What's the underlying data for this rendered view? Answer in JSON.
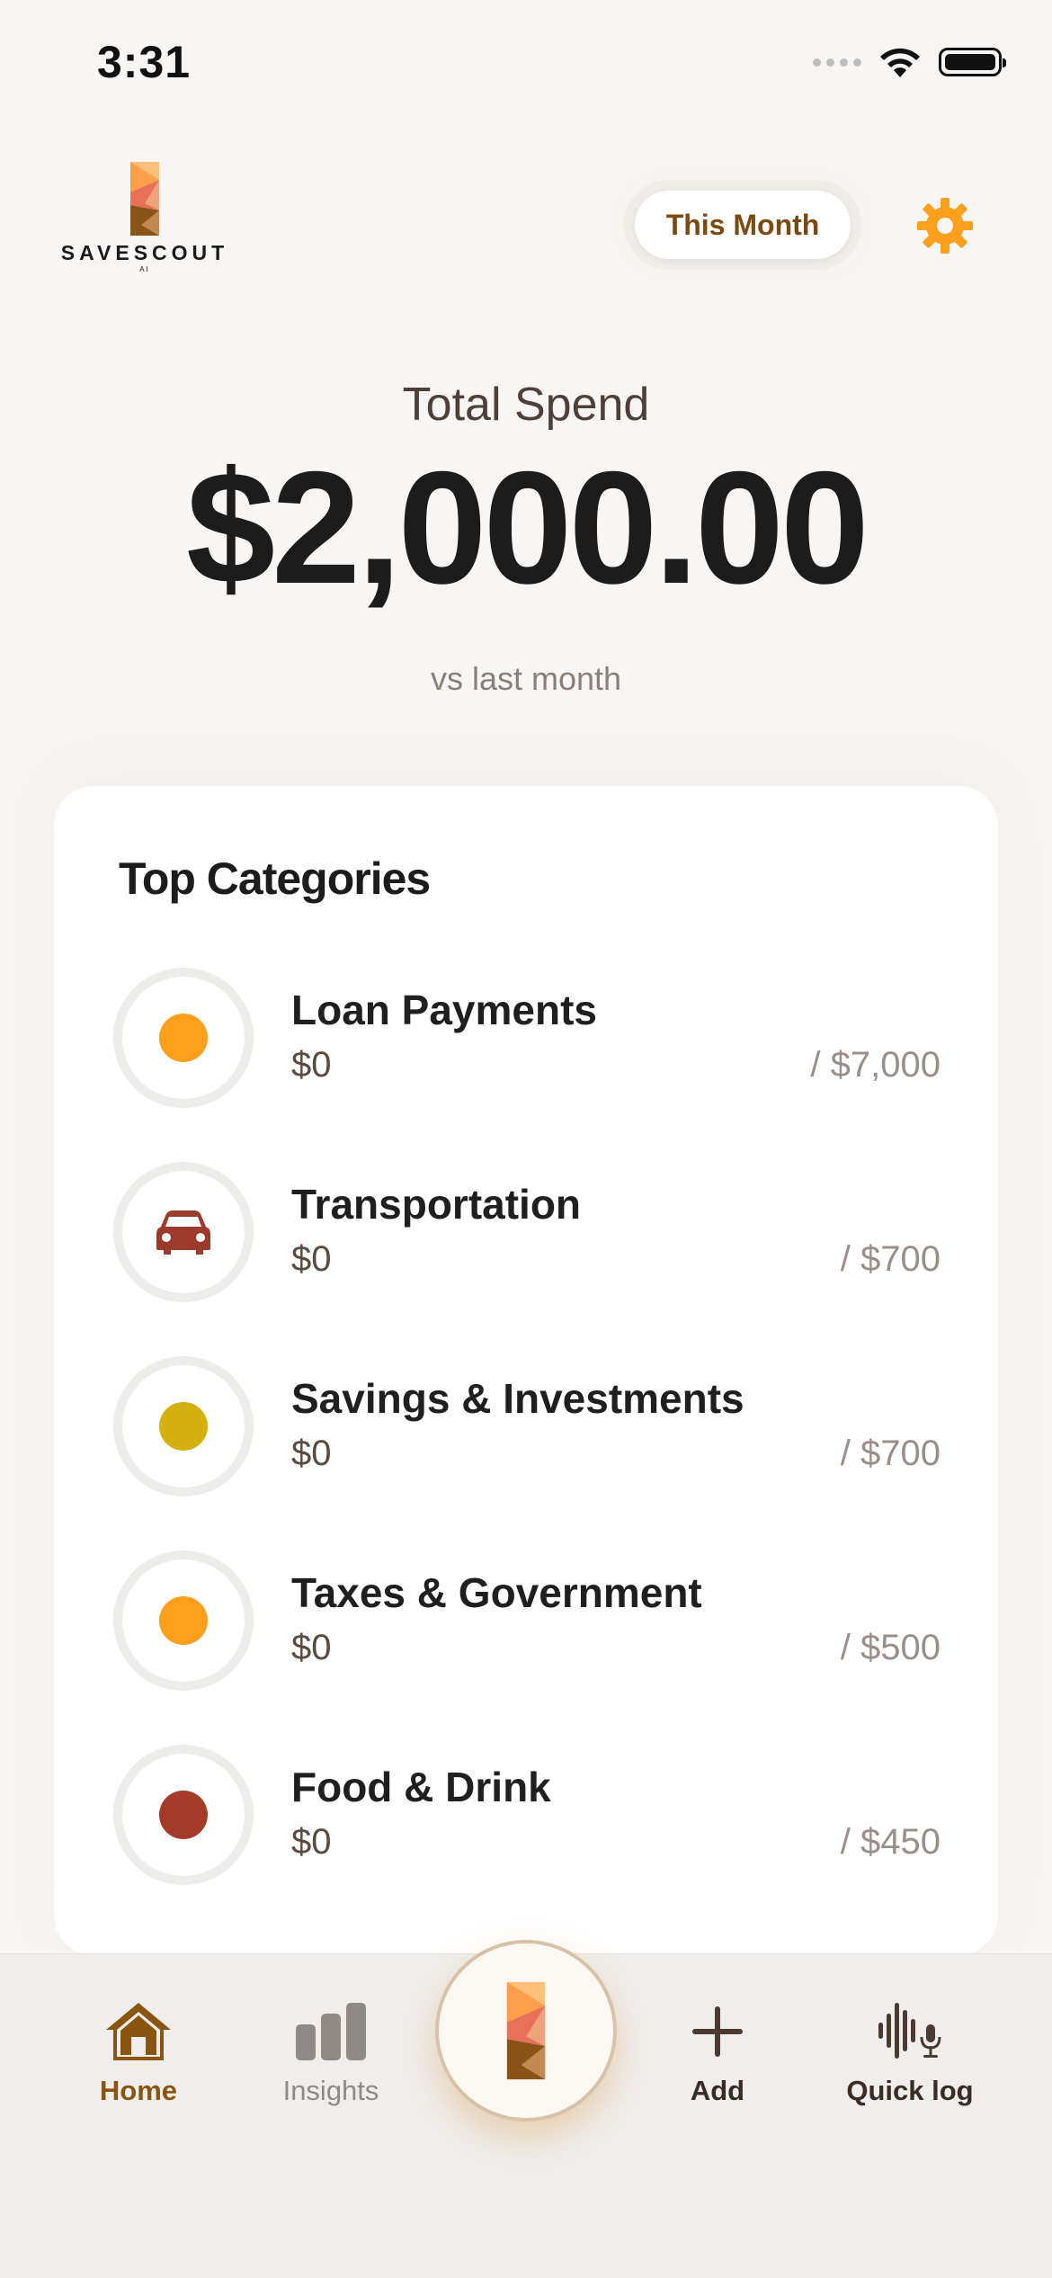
{
  "status_bar": {
    "time": "3:31"
  },
  "header": {
    "logo_text": "SAVESCOUT",
    "logo_sub": "AI",
    "period_label": "This Month"
  },
  "summary": {
    "label": "Total Spend",
    "amount": "$2,000.00",
    "comparison": "vs last month"
  },
  "categories": {
    "title": "Top Categories",
    "items": [
      {
        "name": "Loan Payments",
        "spent": "$0",
        "budget": "/ $7,000",
        "icon": "dot",
        "color": "#ff9f1c"
      },
      {
        "name": "Transportation",
        "spent": "$0",
        "budget": "/ $700",
        "icon": "car-icon",
        "color": "#9c3b2b"
      },
      {
        "name": "Savings & Investments",
        "spent": "$0",
        "budget": "/ $700",
        "icon": "dot",
        "color": "#d4b10e"
      },
      {
        "name": "Taxes & Government",
        "spent": "$0",
        "budget": "/ $500",
        "icon": "dot",
        "color": "#ff9f1c"
      },
      {
        "name": "Food & Drink",
        "spent": "$0",
        "budget": "/ $450",
        "icon": "dot",
        "color": "#a33a2a"
      }
    ]
  },
  "tab_bar": {
    "home": "Home",
    "insights": "Insights",
    "add": "Add",
    "quick_log": "Quick log"
  },
  "colors": {
    "accent": "#ff9f1c",
    "brand_brown": "#7a4a10",
    "tab_active": "#8a5411",
    "tab_inactive": "#8f8a86"
  }
}
